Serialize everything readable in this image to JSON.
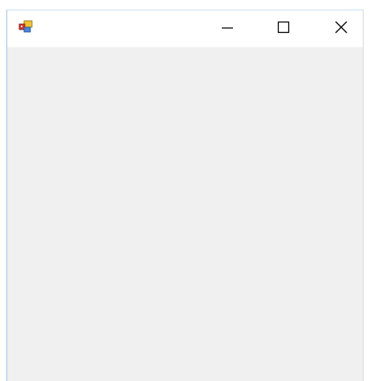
{
  "window": {
    "title": "",
    "app_icon": "winforms-app-icon",
    "controls": {
      "minimize_icon": "minimize-icon",
      "maximize_icon": "maximize-icon",
      "close_icon": "close-icon"
    }
  },
  "colors": {
    "titlebar_bg": "#ffffff",
    "client_bg": "#f0f0f0",
    "window_border": "#9fc4e6"
  }
}
